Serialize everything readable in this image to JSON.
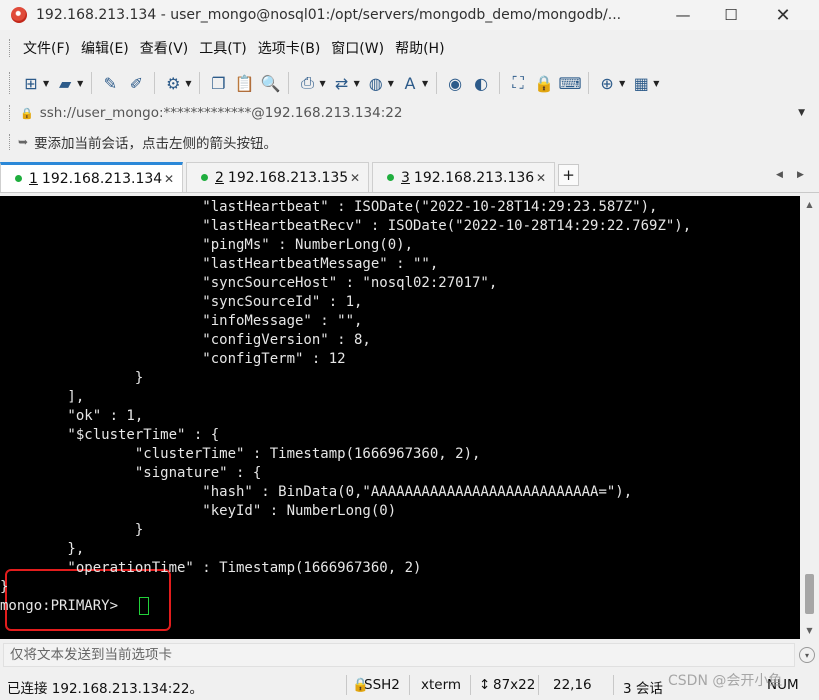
{
  "window": {
    "title": "192.168.213.134 - user_mongo@nosql01:/opt/servers/mongodb_demo/mongodb/...",
    "minimize": "—",
    "maximize": "☐",
    "close": "✕"
  },
  "menu": {
    "items": [
      "文件(F)",
      "编辑(E)",
      "查看(V)",
      "工具(T)",
      "选项卡(B)",
      "窗口(W)",
      "帮助(H)"
    ]
  },
  "toolbar": {
    "buttons": [
      {
        "icon": "new-session-icon",
        "glyph": "⊞",
        "dropdown": true
      },
      {
        "icon": "open-folder-icon",
        "glyph": "▰",
        "dropdown": true
      },
      {
        "icon": "reconnect-icon",
        "glyph": "✎",
        "dropdown": false
      },
      {
        "icon": "disconnect-icon",
        "glyph": "✐",
        "dropdown": false
      },
      {
        "icon": "properties-icon",
        "glyph": "⚙",
        "dropdown": true
      },
      {
        "icon": "copy-icon",
        "glyph": "❐",
        "dropdown": false
      },
      {
        "icon": "paste-icon",
        "glyph": "📋",
        "dropdown": false
      },
      {
        "icon": "find-icon",
        "glyph": "🔍",
        "dropdown": false
      },
      {
        "icon": "print-icon",
        "glyph": "⎙",
        "dropdown": true
      },
      {
        "icon": "transfer-icon",
        "glyph": "⇄",
        "dropdown": true
      },
      {
        "icon": "globe-icon",
        "glyph": "◍",
        "dropdown": true
      },
      {
        "icon": "font-icon",
        "glyph": "A",
        "dropdown": true
      },
      {
        "icon": "xftp-icon",
        "glyph": "◉",
        "dropdown": false
      },
      {
        "icon": "xshell-icon",
        "glyph": "◐",
        "dropdown": false
      },
      {
        "icon": "fullscreen-icon",
        "glyph": "⛶",
        "dropdown": false
      },
      {
        "icon": "lock-icon",
        "glyph": "🔒",
        "dropdown": false
      },
      {
        "icon": "keyboard-icon",
        "glyph": "⌨",
        "dropdown": false
      },
      {
        "icon": "compose-icon",
        "glyph": "⊕",
        "dropdown": true
      },
      {
        "icon": "layout-icon",
        "glyph": "▦",
        "dropdown": true
      }
    ]
  },
  "address": {
    "value": "ssh://user_mongo:*************@192.168.213.134:22",
    "dropdown": "▼"
  },
  "hint": {
    "text": "要添加当前会话，点击左侧的箭头按钮。"
  },
  "tabs": [
    {
      "num": "1",
      "label": "192.168.213.134",
      "active": true,
      "close": "✕"
    },
    {
      "num": "2",
      "label": "192.168.213.135",
      "active": false,
      "close": "✕"
    },
    {
      "num": "3",
      "label": "192.168.213.136",
      "active": false,
      "close": "✕"
    }
  ],
  "tab_add": "+",
  "tab_nav": {
    "prev": "◀",
    "next": "▶"
  },
  "terminal": {
    "lines": [
      "                        \"lastHeartbeat\" : ISODate(\"2022-10-28T14:29:23.587Z\"),",
      "                        \"lastHeartbeatRecv\" : ISODate(\"2022-10-28T14:29:22.769Z\"),",
      "                        \"pingMs\" : NumberLong(0),",
      "                        \"lastHeartbeatMessage\" : \"\",",
      "                        \"syncSourceHost\" : \"nosql02:27017\",",
      "                        \"syncSourceId\" : 1,",
      "                        \"infoMessage\" : \"\",",
      "                        \"configVersion\" : 8,",
      "                        \"configTerm\" : 12",
      "                }",
      "        ],",
      "        \"ok\" : 1,",
      "        \"$clusterTime\" : {",
      "                \"clusterTime\" : Timestamp(1666967360, 2),",
      "                \"signature\" : {",
      "                        \"hash\" : BinData(0,\"AAAAAAAAAAAAAAAAAAAAAAAAAAA=\"),",
      "                        \"keyId\" : NumberLong(0)",
      "                }",
      "        },",
      "        \"operationTime\" : Timestamp(1666967360, 2)",
      "}",
      "mongo:PRIMARY> "
    ],
    "text_color": "#e6e6e6",
    "cursor_color": "#22d13a",
    "highlight_color": "#e21d1d"
  },
  "scrollbar": {
    "up": "▲",
    "down": "▼"
  },
  "sendbar": {
    "placeholder": "仅将文本发送到当前选项卡",
    "menu": "▾"
  },
  "status": {
    "connection": "已连接 192.168.213.134:22。",
    "protocol": "SSH2",
    "terminal_type": "xterm",
    "size": "87x22",
    "cursor_pos": "22,16",
    "sessions": "3 会话",
    "keys": "NUM"
  },
  "watermark": "CSDN @会开小鱼"
}
